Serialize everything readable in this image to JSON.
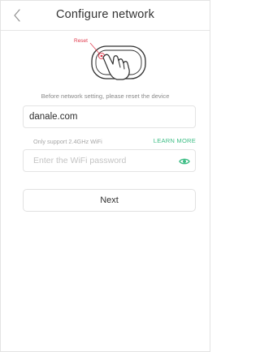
{
  "header": {
    "title": "Configure network",
    "back_icon": "chevron-left-icon"
  },
  "illustration": {
    "reset_label": "Reset",
    "icon": "hand-press-device-icon",
    "accent_color": "#e0384b"
  },
  "instruction": "Before network setting, please reset the device",
  "wifi": {
    "ssid": "danale.com",
    "support_note": "Only support 2.4GHz WiFi",
    "learn_more": "LEARN MORE",
    "password_placeholder": "Enter the WiFi password",
    "password_value": "",
    "eye_icon": "eye-icon"
  },
  "actions": {
    "next_label": "Next"
  },
  "colors": {
    "accent": "#3dbd85",
    "reset_red": "#e0384b"
  }
}
